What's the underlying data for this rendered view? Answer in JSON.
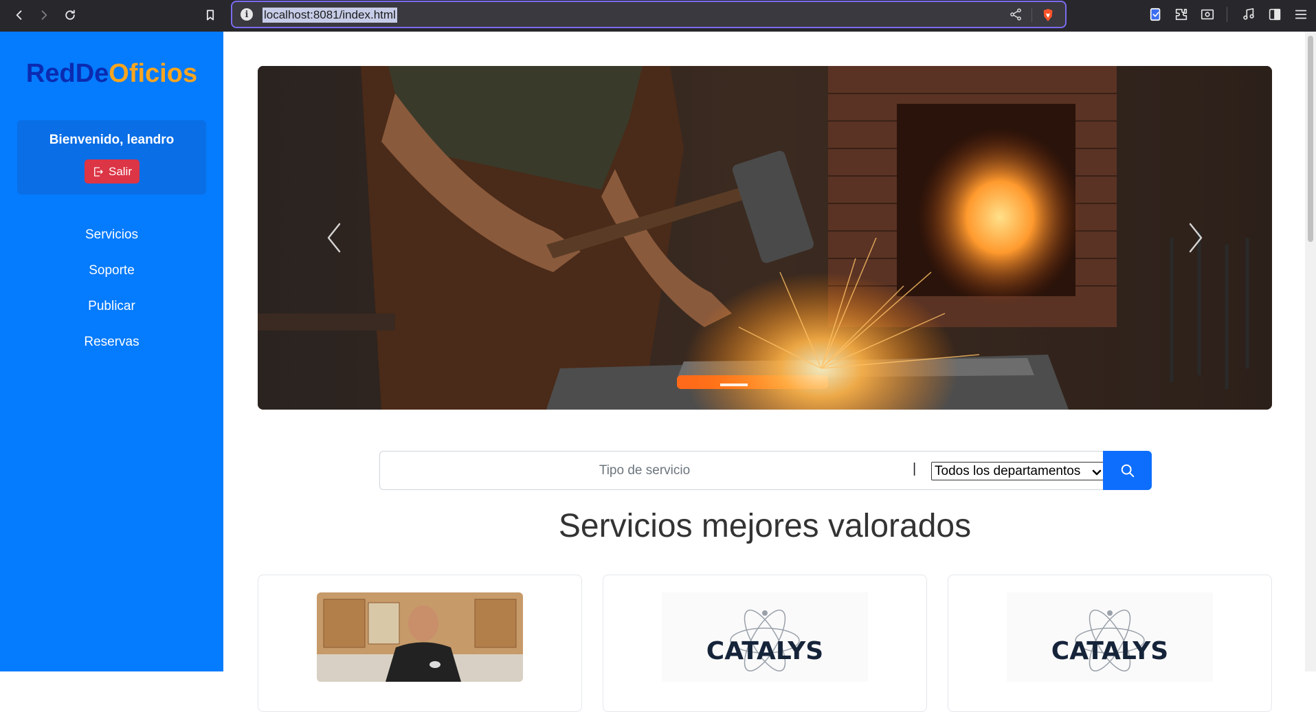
{
  "browser": {
    "url": "localhost:8081/index.html",
    "icons": [
      "back-icon",
      "forward-icon",
      "reload-icon",
      "bookmark-icon",
      "site-info-icon",
      "share-icon",
      "brave-shields-icon",
      "vpn-icon",
      "extensions-icon",
      "reader-icon",
      "media-icon",
      "sidebar-icon",
      "menu-icon"
    ]
  },
  "sidebar": {
    "logo_part1": "RedDe",
    "logo_part2": "Oficios",
    "welcome": "Bienvenido, leandro",
    "logout_label": "Salir",
    "links": [
      {
        "label": "Servicios"
      },
      {
        "label": "Soporte"
      },
      {
        "label": "Publicar"
      },
      {
        "label": "Reservas"
      }
    ]
  },
  "main": {
    "search": {
      "placeholder": "Tipo de servicio",
      "separator": "|",
      "department": "Todos los departamentos"
    },
    "section_title": "Servicios mejores valorados",
    "cards": [
      {
        "image": "worker-kitchen-photo"
      },
      {
        "image": "catalys-logo",
        "logo_text": "CATALYS"
      },
      {
        "image": "catalys-logo",
        "logo_text": "CATALYS"
      }
    ]
  },
  "colors": {
    "sidebar_bg": "#057bfd",
    "logo_primary": "#0b2bb0",
    "logo_accent": "#f7a520",
    "danger": "#dc3545",
    "primary": "#0d6efd"
  }
}
